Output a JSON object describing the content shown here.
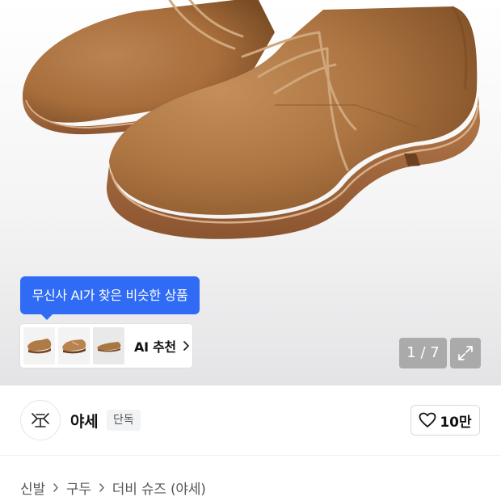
{
  "product_image": {
    "alt_subject": "shoe-photo",
    "page_current": "1",
    "page_separator": "/",
    "page_total": "7",
    "page_indicator_text": "1 / 7"
  },
  "ai_recommend": {
    "tooltip": "무신사 AI가 찾은 비슷한 상품",
    "button_label": "AI 추천",
    "thumbnails": [
      "shoe-thumbnail-1",
      "shoe-thumbnail-2",
      "shoe-thumbnail-3"
    ]
  },
  "brand": {
    "name": "야세",
    "badge": "단독",
    "logo_icon": "brand-logo-icon"
  },
  "like": {
    "icon": "heart-icon",
    "count": "10만"
  },
  "breadcrumb": {
    "items": [
      "신발",
      "구두",
      "더비 슈즈 (야세)"
    ],
    "separator_icon": "chevron-right-icon"
  },
  "colors": {
    "accent_blue": "#2f6bf5",
    "suede_brown": "#b27a45",
    "badge_bg": "#f2f3f5"
  }
}
